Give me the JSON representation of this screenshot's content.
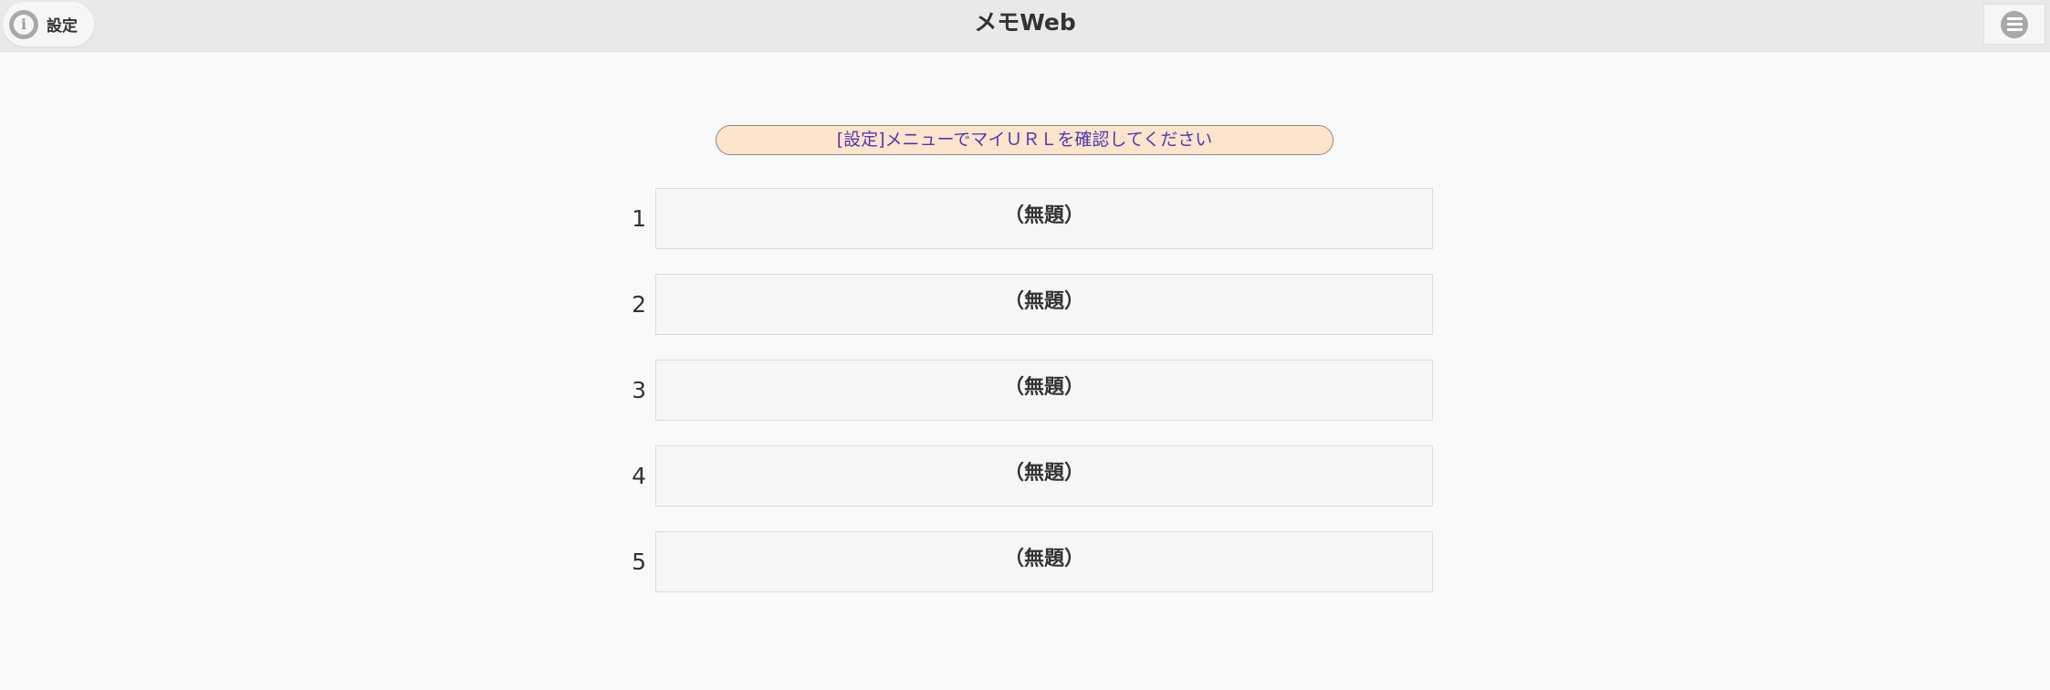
{
  "header": {
    "title": "メモWeb",
    "settings_label": "設定",
    "settings_icon": "info-icon",
    "menu_icon": "hamburger-menu-icon"
  },
  "notice": {
    "text": "[設定]メニューでマイＵＲＬを確認してください"
  },
  "memos": [
    {
      "number": "1",
      "title": "（無題）"
    },
    {
      "number": "2",
      "title": "（無題）"
    },
    {
      "number": "3",
      "title": "（無題）"
    },
    {
      "number": "4",
      "title": "（無題）"
    },
    {
      "number": "5",
      "title": "（無題）"
    }
  ],
  "colors": {
    "header_bg": "#e9e9e9",
    "notice_bg": "#ffe4cc",
    "notice_text": "#4a3bb5",
    "page_bg": "#f9f9f9"
  }
}
